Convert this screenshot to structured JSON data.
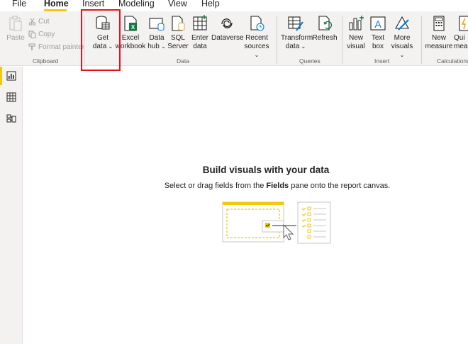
{
  "menu": {
    "items": [
      "File",
      "Home",
      "Insert",
      "Modeling",
      "View",
      "Help"
    ],
    "active": "Home"
  },
  "clipboard": {
    "paste": "Paste",
    "cut": "Cut",
    "copy": "Copy",
    "format_painter": "Format painter",
    "group_label": "Clipboard"
  },
  "data": {
    "get_data": [
      "Get",
      "data"
    ],
    "excel": [
      "Excel",
      "workbook"
    ],
    "data_hub": [
      "Data",
      "hub"
    ],
    "sql": [
      "SQL",
      "Server"
    ],
    "enter": [
      "Enter",
      "data"
    ],
    "dataverse": "Dataverse",
    "recent": [
      "Recent",
      "sources"
    ],
    "group_label": "Data"
  },
  "queries": {
    "transform": [
      "Transform",
      "data"
    ],
    "refresh": "Refresh",
    "group_label": "Queries"
  },
  "insert": {
    "new_visual": [
      "New",
      "visual"
    ],
    "text_box": [
      "Text",
      "box"
    ],
    "more_visuals": [
      "More",
      "visuals"
    ],
    "group_label": "Insert"
  },
  "calculations": {
    "new_measure": [
      "New",
      "measure"
    ],
    "quick_measure": [
      "Qui",
      "meas"
    ],
    "group_label": "Calculations"
  },
  "canvas": {
    "title": "Build visuals with your data",
    "subtitle_pre": "Select or drag fields from the ",
    "subtitle_bold": "Fields",
    "subtitle_post": " pane onto the report canvas."
  },
  "colors": {
    "accent": "#f2c811",
    "highlight": "#e8111b"
  }
}
